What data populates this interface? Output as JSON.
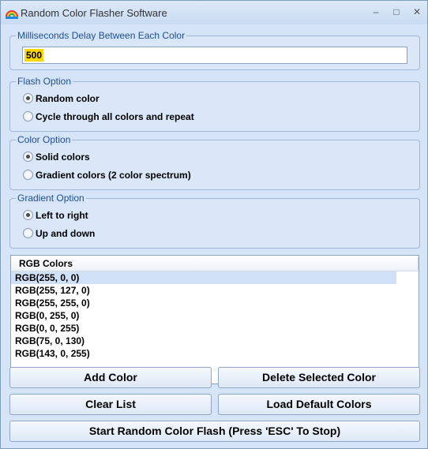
{
  "window": {
    "title": "Random Color Flasher Software",
    "minimize_glyph": "–",
    "maximize_glyph": "□",
    "close_glyph": "✕"
  },
  "delay": {
    "legend": "Milliseconds Delay Between Each Color",
    "value": "500"
  },
  "flash_option": {
    "legend": "Flash Option",
    "options": [
      {
        "label": "Random color",
        "checked": true
      },
      {
        "label": "Cycle through all colors and repeat",
        "checked": false
      }
    ]
  },
  "color_option": {
    "legend": "Color Option",
    "options": [
      {
        "label": "Solid colors",
        "checked": true
      },
      {
        "label": "Gradient colors (2 color spectrum)",
        "checked": false
      }
    ]
  },
  "gradient_option": {
    "legend": "Gradient Option",
    "options": [
      {
        "label": "Left to right",
        "checked": true
      },
      {
        "label": "Up and down",
        "checked": false
      }
    ]
  },
  "colors_list": {
    "header": "RGB Colors",
    "rows": [
      "RGB(255, 0, 0)",
      "RGB(255, 127, 0)",
      "RGB(255, 255, 0)",
      "RGB(0, 255, 0)",
      "RGB(0, 0, 255)",
      "RGB(75, 0, 130)",
      "RGB(143, 0, 255)"
    ],
    "selected_index": 0
  },
  "buttons": {
    "add_color": "Add Color",
    "delete_selected": "Delete Selected Color",
    "clear_list": "Clear List",
    "load_default": "Load Default Colors",
    "start_flash": "Start Random Color Flash (Press 'ESC' To Stop)"
  },
  "colors": {
    "accent_legend": "#1f4f8f",
    "input_highlight": "#ffd700",
    "selected_row": "#cfe0f7"
  }
}
